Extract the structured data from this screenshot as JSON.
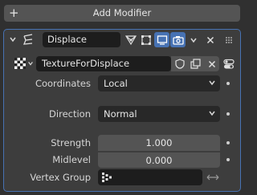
{
  "toolbar": {
    "add_modifier_label": "Add Modifier"
  },
  "modifier": {
    "name": "Displace",
    "texture_name": "TextureForDisplace",
    "properties": {
      "coordinates": {
        "label": "Coordinates",
        "value": "Local"
      },
      "direction": {
        "label": "Direction",
        "value": "Normal"
      },
      "strength": {
        "label": "Strength",
        "value": "1.000"
      },
      "midlevel": {
        "label": "Midlevel",
        "value": "0.000"
      },
      "vertex_group": {
        "label": "Vertex Group",
        "value": ""
      }
    }
  },
  "colors": {
    "accent": "#4772b3",
    "panel_bg": "#3d3d3d",
    "field_bg": "#1d1d1d",
    "button_bg": "#545454"
  },
  "icons": [
    "plus-icon",
    "collapse-chevron-icon",
    "displace-modifier-icon",
    "vertex-edit-icon",
    "edit-mode-icon",
    "realtime-icon",
    "render-icon",
    "dropdown-chevron-icon",
    "close-icon",
    "drag-handle-icon",
    "checker-texture-icon",
    "fake-user-shield-icon",
    "duplicate-icon",
    "unlink-icon",
    "texture-properties-icon",
    "vertex-group-icon",
    "swap-arrows-icon"
  ]
}
